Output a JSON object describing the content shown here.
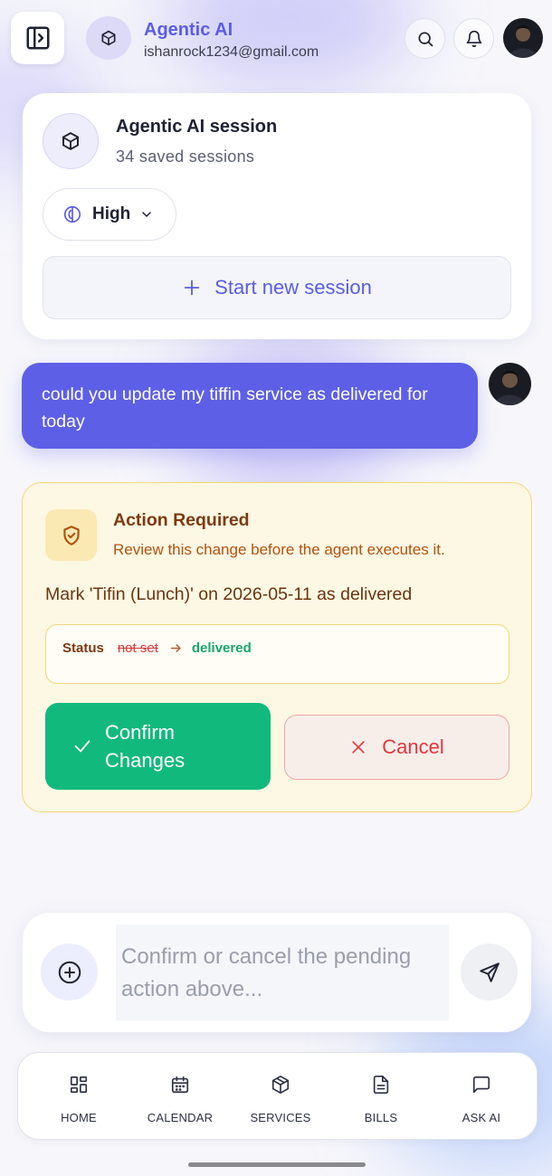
{
  "header": {
    "app_name": "Agentic AI",
    "account_email": "ishanrock1234@gmail.com"
  },
  "session": {
    "title": "Agentic AI session",
    "saved_count": "34 saved sessions",
    "mode_label": "High",
    "new_session_label": "Start new session"
  },
  "conversation": {
    "user_message": "could you update my tiffin service as delivered for today"
  },
  "action": {
    "title": "Action Required",
    "subtitle": "Review this change before the agent executes it.",
    "description": "Mark 'Tifin (Lunch)' on 2026-05-11 as delivered",
    "change": {
      "field": "Status",
      "old_value": "not set",
      "new_value": "delivered"
    },
    "confirm_label": "Confirm Changes",
    "cancel_label": "Cancel"
  },
  "composer": {
    "placeholder": "Confirm or cancel the pending action above..."
  },
  "nav": {
    "items": [
      {
        "label": "HOME",
        "icon": "home-grid-icon"
      },
      {
        "label": "CALENDAR",
        "icon": "calendar-icon"
      },
      {
        "label": "SERVICES",
        "icon": "package-icon"
      },
      {
        "label": "BILLS",
        "icon": "document-icon"
      },
      {
        "label": "ASK AI",
        "icon": "chat-icon"
      }
    ]
  },
  "colors": {
    "accent": "#5d5fe6",
    "warning_bg": "#fdf8e3",
    "warning_border": "#f5d77c",
    "confirm": "#12b97d",
    "cancel": "#e5353d"
  }
}
